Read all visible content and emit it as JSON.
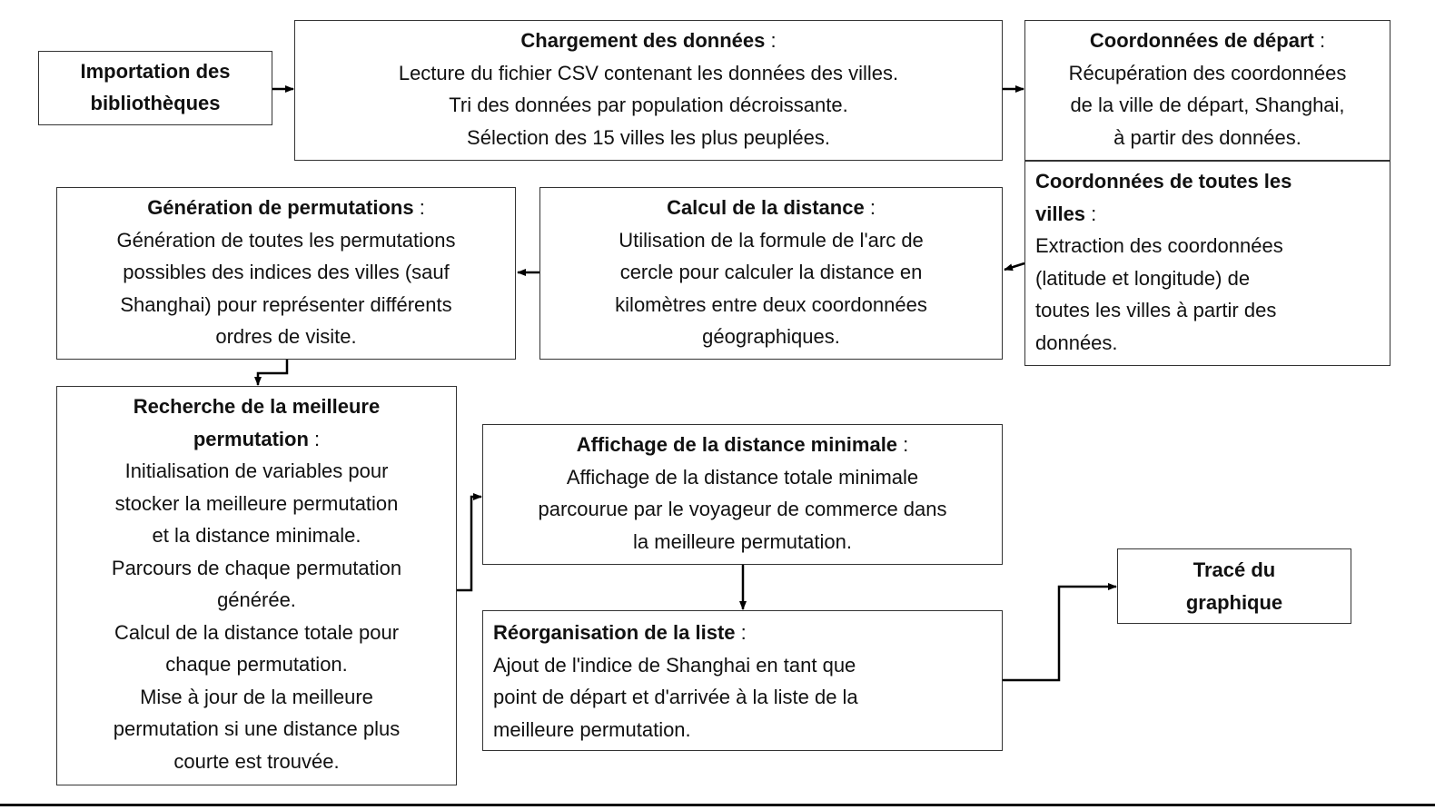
{
  "boxes": [
    {
      "id": "b-import",
      "name": "importation-bibliotheques",
      "align": "center",
      "title_lines": [
        "Importation des",
        "bibliothèques"
      ],
      "colon": false,
      "lines": []
    },
    {
      "id": "b-load",
      "name": "chargement-donnees",
      "align": "center",
      "title_lines": [
        "Chargement des données"
      ],
      "colon": true,
      "lines": [
        "Lecture du fichier CSV contenant les données des villes.",
        "Tri des données par population décroissante.",
        "Sélection des 15 villes les plus peuplées."
      ]
    },
    {
      "id": "b-start",
      "name": "coordonnees-depart",
      "align": "center",
      "title_lines": [
        "Coordonnées de départ"
      ],
      "colon": true,
      "lines": [
        "Récupération des coordonnées",
        "de la ville de départ, Shanghai,",
        "à partir des données."
      ]
    },
    {
      "id": "b-all",
      "name": "coordonnees-toutes-villes",
      "align": "left",
      "title_lines": [
        "Coordonnées de toutes les",
        "villes"
      ],
      "colon": true,
      "lines": [
        "Extraction des coordonnées",
        "(latitude et longitude) de",
        "toutes les villes à partir des",
        "données."
      ]
    },
    {
      "id": "b-dist",
      "name": "calcul-distance",
      "align": "center",
      "title_lines": [
        "Calcul de la distance"
      ],
      "colon": true,
      "lines": [
        "Utilisation de la formule de l'arc de",
        "cercle pour calculer la distance en",
        "kilomètres entre deux coordonnées",
        "géographiques."
      ]
    },
    {
      "id": "b-gen",
      "name": "generation-permutations",
      "align": "center",
      "title_lines": [
        "Génération de permutations"
      ],
      "colon": true,
      "lines": [
        "Génération de toutes les permutations",
        "possibles des indices des villes (sauf",
        "Shanghai) pour représenter différents",
        "ordres de visite."
      ]
    },
    {
      "id": "b-search",
      "name": "recherche-meilleure-permutation",
      "align": "center",
      "title_lines": [
        "Recherche de la meilleure",
        "permutation"
      ],
      "colon": true,
      "lines": [
        "Initialisation de variables pour",
        "stocker la meilleure permutation",
        "et la distance minimale.",
        "Parcours de chaque permutation",
        "générée.",
        "Calcul de la distance totale pour",
        "chaque permutation.",
        "Mise à jour de la meilleure",
        "permutation si une distance plus",
        "courte est trouvée."
      ]
    },
    {
      "id": "b-show",
      "name": "affichage-distance-minimale",
      "align": "center",
      "title_lines": [
        "Affichage de la distance minimale"
      ],
      "colon": true,
      "lines": [
        "Affichage de la distance totale minimale",
        "parcourue par le voyageur de commerce dans",
        "la meilleure permutation."
      ]
    },
    {
      "id": "b-reorg",
      "name": "reorganisation-liste",
      "align": "left",
      "title_lines": [
        "Réorganisation de la liste"
      ],
      "colon": true,
      "lines": [
        "Ajout de l'indice de Shanghai en tant que",
        "point de départ et d'arrivée à la liste de la",
        "meilleure permutation."
      ]
    },
    {
      "id": "b-plot",
      "name": "trace-graphique",
      "align": "center",
      "title_lines": [
        "Tracé du",
        "graphique"
      ],
      "colon": false,
      "lines": []
    }
  ],
  "colon_text": " :"
}
